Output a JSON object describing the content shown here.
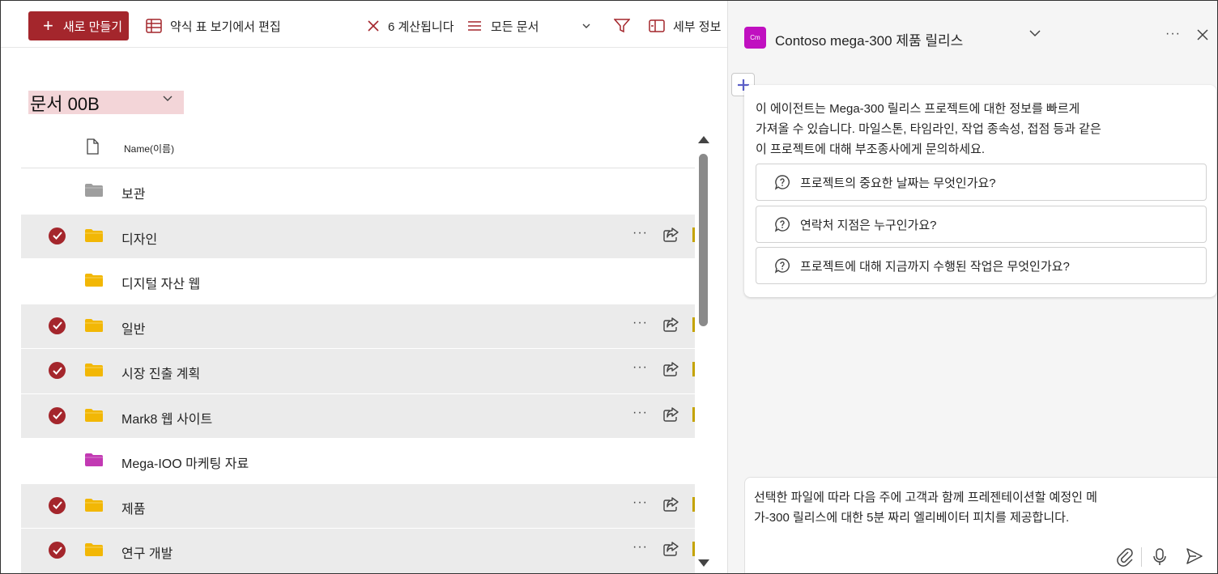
{
  "toolbar": {
    "new_label": "새로 만들기",
    "quick_edit_label": "약식 표 보기에서 편집",
    "cancel_label": "6 계산됩니다",
    "view_label": "모든 문서",
    "details_label": "세부 정보"
  },
  "library": {
    "title": "문서 00B",
    "column_name": "Name(이름)",
    "rows": [
      {
        "name": "보관",
        "selected": false,
        "folder_color": "#9e9e9e"
      },
      {
        "name": "디자인",
        "selected": true,
        "folder_color": "#f2b705"
      },
      {
        "name": "디지털 자산 웹",
        "selected": false,
        "folder_color": "#f2b705"
      },
      {
        "name": "일반",
        "selected": true,
        "folder_color": "#f2b705"
      },
      {
        "name": "시장 진출 계획",
        "selected": true,
        "folder_color": "#f2b705"
      },
      {
        "name": "Mark8 웹 사이트",
        "selected": true,
        "folder_color": "#f2b705"
      },
      {
        "name": "Mega-IOO 마케팅 자료",
        "selected": false,
        "folder_color": "#c239b3"
      },
      {
        "name": "제품",
        "selected": true,
        "folder_color": "#f2b705"
      },
      {
        "name": "연구 개발",
        "selected": true,
        "folder_color": "#f2b705"
      }
    ]
  },
  "agent": {
    "avatar_text": "Cm",
    "title": "Contoso  mega-300 제품 릴리스",
    "intro_line1": "이 에이전트는 Mega-300 릴리스 프로젝트에 대한 정보를 빠르게",
    "intro_line2": "가져올 수 있습니다. 마일스톤, 타임라인, 작업 종속성, 접점 등과 같은",
    "intro_line3": "이 프로젝트에 대해 부조종사에게 문의하세요.",
    "prompts": [
      "프로젝트의 중요한 날짜는 무엇인가요?",
      "연락처 지점은 누구인가요?",
      "프로젝트에 대해 지금까지 수행된 작업은 무엇인가요?"
    ],
    "compose_line1": "선택한 파일에 따라 다음 주에 고객과 함께 프레젠테이션할 예정인 메",
    "compose_line2": "가-300 릴리스에 대한 5분 짜리 엘리베이터 피치를 제공합니다."
  },
  "colors": {
    "accent": "#a4262c",
    "selected_row": "#ebebeb",
    "agent_avatar": "#c010c0",
    "new_chat_plus": "#5b5fc7"
  }
}
